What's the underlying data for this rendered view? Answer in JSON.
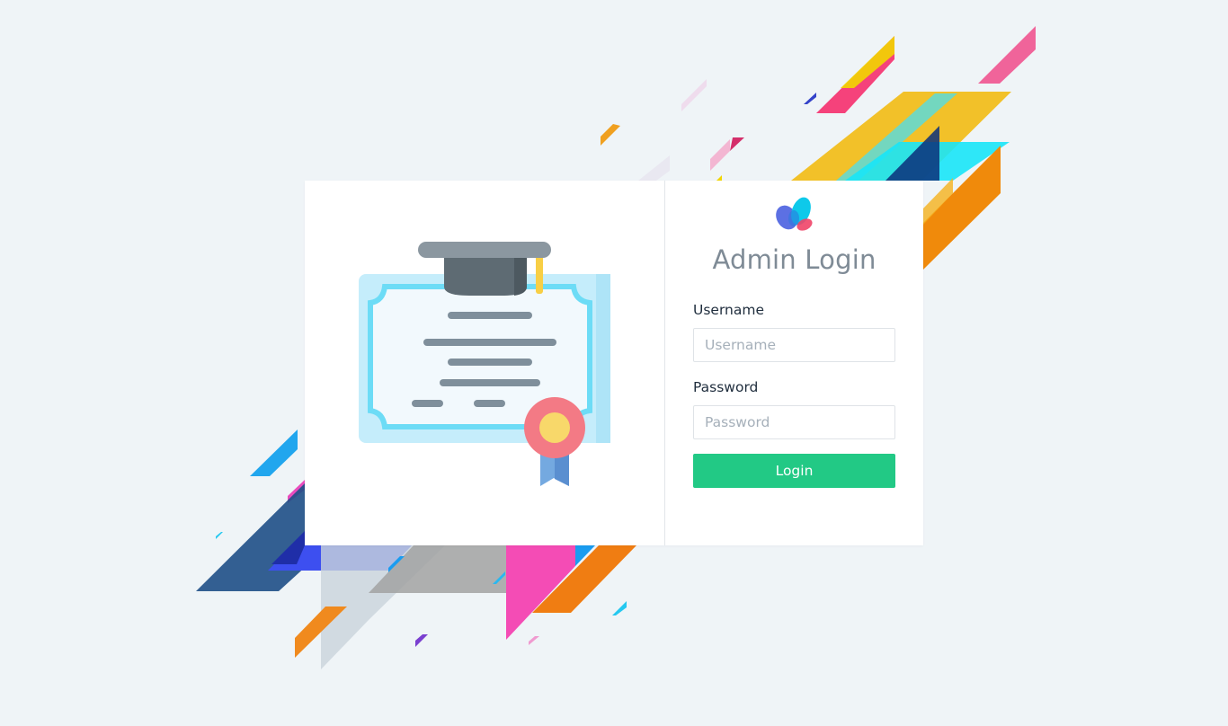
{
  "illustration": {
    "icon": "graduation-certificate-icon"
  },
  "logo": {
    "icon": "butterfly-logo-icon"
  },
  "login_form": {
    "title": "Admin Login",
    "username_label": "Username",
    "username_placeholder": "Username",
    "username_value": "",
    "password_label": "Password",
    "password_placeholder": "Password",
    "password_value": "",
    "login_button": "Login"
  },
  "colors": {
    "background": "#eff4f7",
    "accent_button": "#22c985",
    "title_text": "#7f8b96"
  }
}
